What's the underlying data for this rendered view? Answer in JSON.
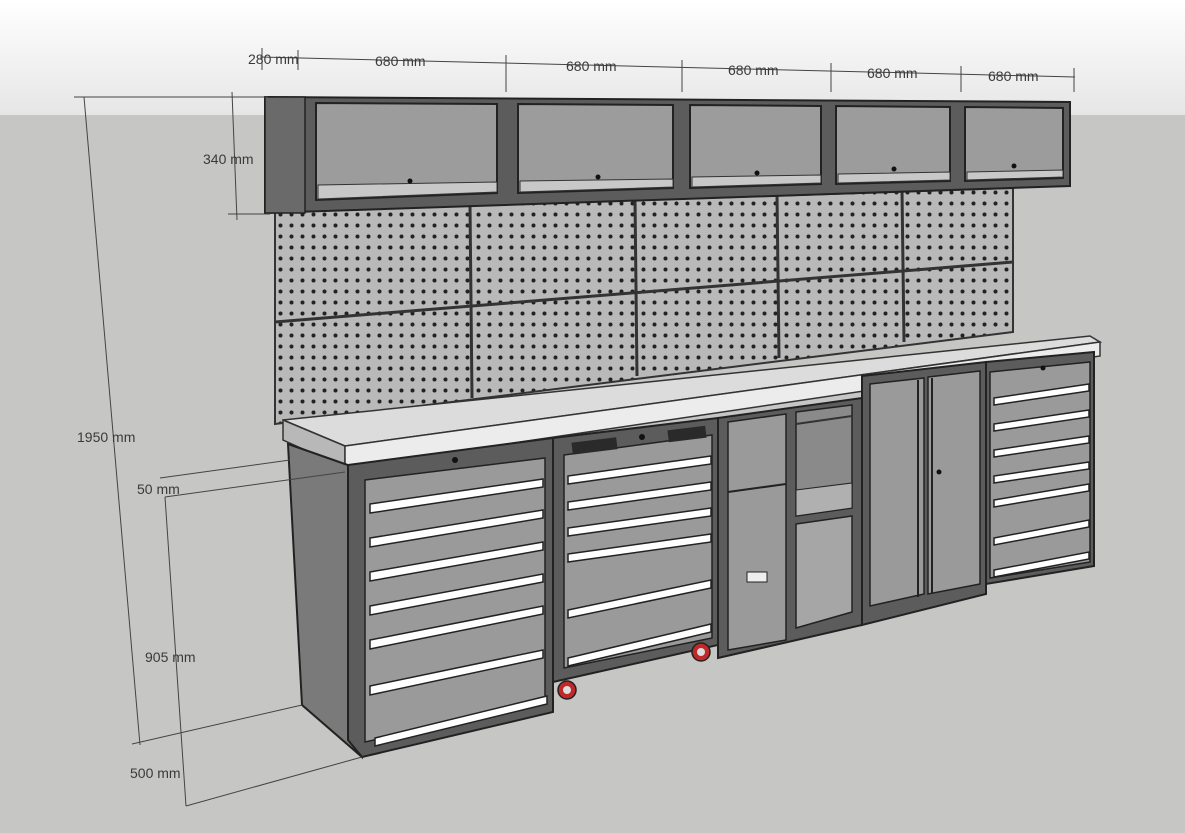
{
  "dimensions": {
    "top_widths": [
      "280 mm",
      "680 mm",
      "680 mm",
      "680 mm",
      "680 mm",
      "680 mm"
    ],
    "cabinet_height": "340 mm",
    "total_height": "1950 mm",
    "worktop_thickness": "50 mm",
    "bench_height": "905 mm",
    "depth": "500 mm"
  },
  "colors": {
    "background": "#c6c6c4",
    "sky": "#ececec",
    "cabinet_frame": "#5c5c5c",
    "cabinet_panel": "#9a9a9a",
    "pegboard": "#b4b4b4",
    "worktop": "#d8d8d8",
    "drawer_handle": "#ffffff",
    "caster": "#c0282a"
  }
}
